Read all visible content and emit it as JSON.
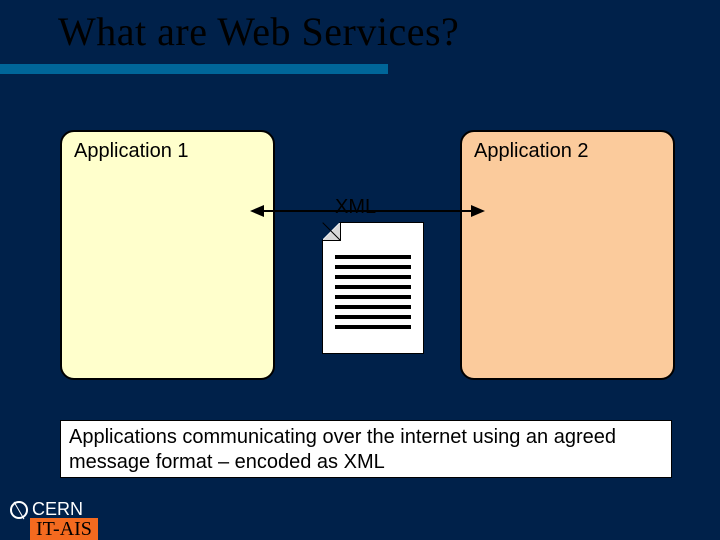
{
  "title": "What are Web Services?",
  "app1": {
    "label": "Application 1"
  },
  "app2": {
    "label": "Application 2"
  },
  "xml": {
    "label": "XML"
  },
  "caption": "Applications communicating over the internet  using an agreed message format – encoded as XML",
  "footer": {
    "org": "CERN",
    "dept": "IT-AIS"
  }
}
